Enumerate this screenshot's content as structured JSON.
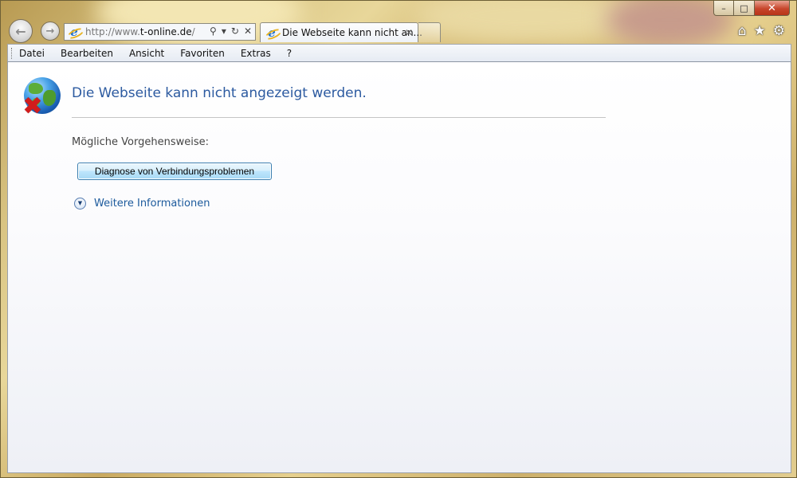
{
  "window": {
    "minimize_glyph": "–",
    "maximize_glyph": "□",
    "close_glyph": "✕"
  },
  "toolbar": {
    "back_glyph": "←",
    "forward_glyph": "→",
    "url_prefix": "http://www.",
    "url_domain": "t-online.de",
    "url_suffix": "/",
    "search_glyph": "⚲",
    "dropdown_glyph": "▾",
    "refresh_glyph": "↻",
    "stop_glyph": "✕"
  },
  "tabs": [
    {
      "label": "Die Webseite kann nicht an...",
      "close_glyph": "✕",
      "icon": "ie-icon"
    }
  ],
  "right_icons": [
    {
      "name": "home-icon",
      "glyph": "⌂"
    },
    {
      "name": "favorites-star-icon",
      "glyph": "★"
    },
    {
      "name": "tools-gear-icon",
      "glyph": "⚙"
    }
  ],
  "menu": {
    "items": [
      "Datei",
      "Bearbeiten",
      "Ansicht",
      "Favoriten",
      "Extras",
      "?"
    ]
  },
  "error_page": {
    "title": "Die Webseite kann nicht angezeigt werden.",
    "subtitle": "Mögliche Vorgehensweise:",
    "diagnose_button": "Diagnose von Verbindungsproblemen",
    "more_info_label": "Weitere Informationen",
    "more_info_glyph": "▼",
    "error_icon": "globe-error-icon"
  },
  "colors": {
    "title_blue": "#2c5aa0",
    "link_blue": "#1c5a9c",
    "error_red": "#d31c1c"
  }
}
